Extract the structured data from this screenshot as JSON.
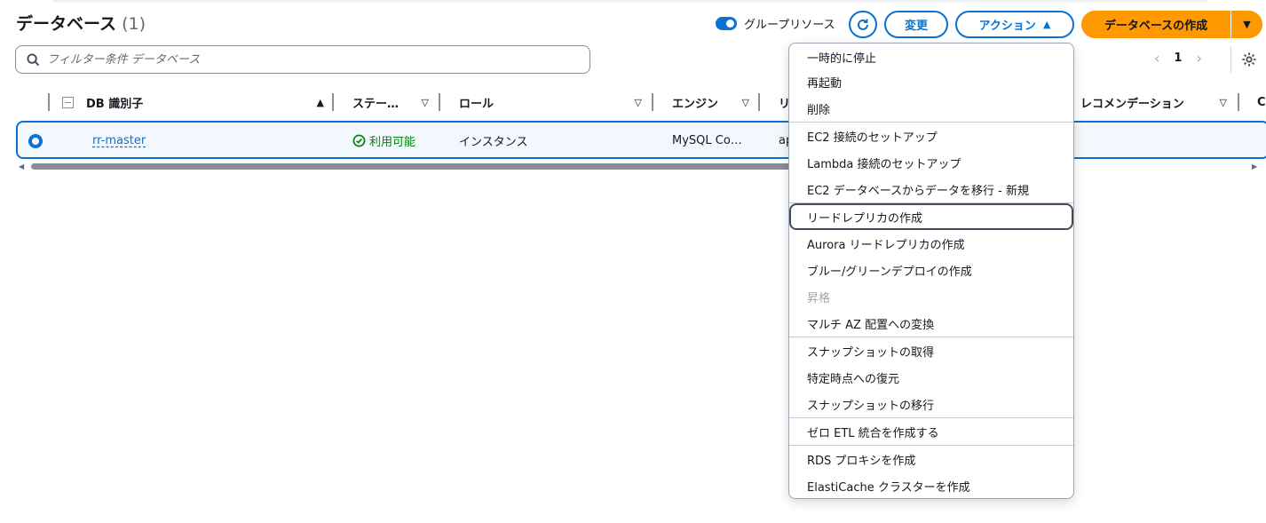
{
  "header": {
    "title": "データベース",
    "count": "(1)",
    "group_toggle_label": "グループリソース",
    "modify_label": "変更",
    "actions_label": "アクション",
    "create_label": "データベースの作成"
  },
  "search": {
    "placeholder": "フィルター条件 データベース"
  },
  "pager": {
    "page": "1"
  },
  "table": {
    "columns": [
      "DB 識別子",
      "ステー…",
      "ロール",
      "エンジン",
      "リ",
      "レコメンデーション",
      "C"
    ],
    "rows": [
      {
        "id": "rr-master",
        "status": "利用可能",
        "role": "インスタンス",
        "engine": "MySQL Co…",
        "region": "ap"
      }
    ]
  },
  "menu": {
    "items": [
      "一時的に停止",
      "再起動",
      "削除",
      "EC2 接続のセットアップ",
      "Lambda 接続のセットアップ",
      "EC2 データベースからデータを移行 - 新規",
      "リードレプリカの作成",
      "Aurora リードレプリカの作成",
      "ブルー/グリーンデプロイの作成",
      "昇格",
      "マルチ AZ 配置への変換",
      "スナップショットの取得",
      "特定時点への復元",
      "スナップショットの移行",
      "ゼロ ETL 統合を作成する",
      "RDS プロキシを作成",
      "ElastiCache クラスターを作成"
    ]
  },
  "colors": {
    "accent": "#0972d3",
    "primary": "#ff9900",
    "success": "#037f0c"
  }
}
